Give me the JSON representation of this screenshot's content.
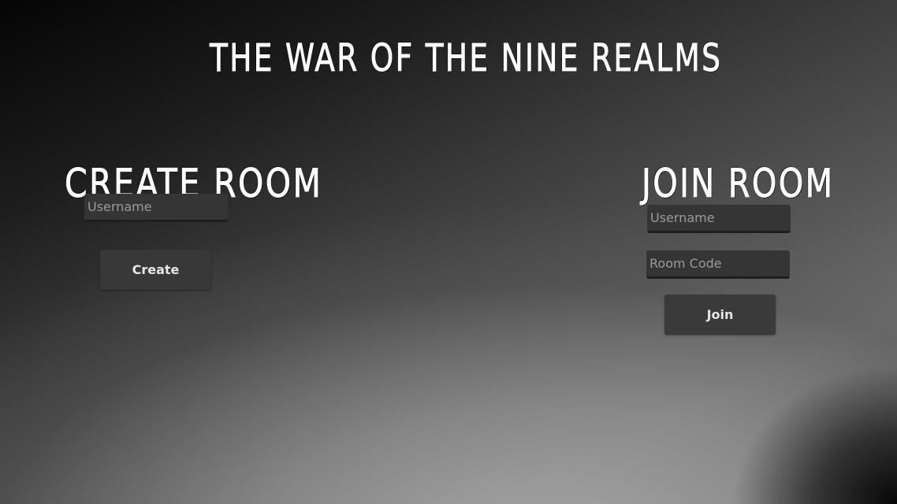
{
  "title": "THE WAR OF THE NINE REALMS",
  "create_room": {
    "heading": "CREATE ROOM",
    "username_placeholder": "Username",
    "username_value": "",
    "button_label": "Create"
  },
  "join_room": {
    "heading": "JOIN ROOM",
    "username_placeholder": "Username",
    "username_value": "",
    "room_code_placeholder": "Room Code",
    "room_code_value": "",
    "button_label": "Join"
  },
  "colors": {
    "title_text": "#ffffff",
    "input_background": "#353535",
    "button_background": "#383838",
    "button_text": "#e6e6e6",
    "placeholder_text": "#9a9a9a"
  }
}
